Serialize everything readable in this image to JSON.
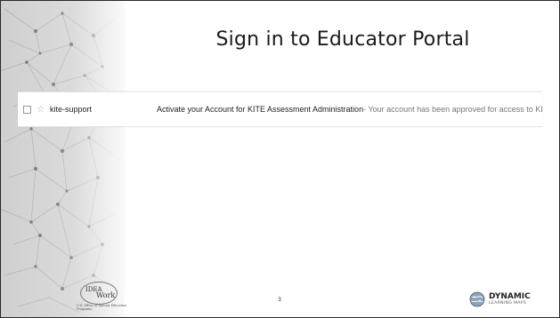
{
  "slide": {
    "title": "Sign in to Educator Portal",
    "page_number": "3"
  },
  "email_row": {
    "sender": "kite-support",
    "subject": "Activate your Account for KITE Assessment Administration",
    "snippet": " - Your account has been approved for access to KITE. Your username is '"
  },
  "logos": {
    "idea_line1": "IDEA",
    "idea_line2": "Work",
    "osep_text": "U.S. Office of Special Education Programs",
    "dlm_name": "DYNAMIC",
    "dlm_sub": "LEARNING MAPS"
  },
  "icons": {
    "checkbox": "checkbox-icon",
    "star": "star-icon"
  },
  "colors": {
    "background": "#ffffff",
    "title_text": "#1a1a1a",
    "network_pattern": "#8a8a8a"
  }
}
